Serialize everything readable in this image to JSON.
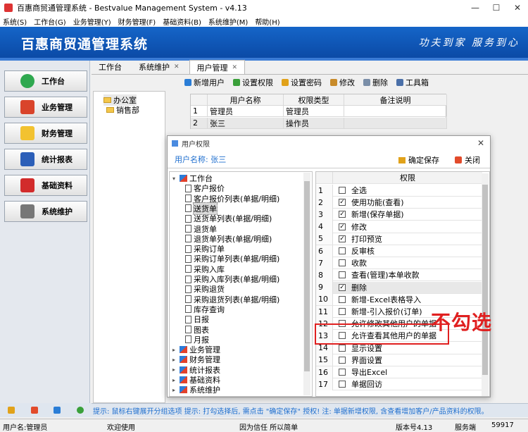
{
  "window": {
    "title": "百惠商贸通管理系统 - Bestvalue Management System - v4.13",
    "min": "—",
    "max": "☐",
    "close": "✕"
  },
  "menu": [
    "系统(S)",
    "工作台(G)",
    "业务管理(Y)",
    "财务管理(F)",
    "基础资料(B)",
    "系统维护(M)",
    "帮助(H)"
  ],
  "banner": {
    "logo": "百惠商贸通管理系统",
    "slogan": "功夫到家  服务到心"
  },
  "nav": [
    {
      "label": "工作台",
      "icon": "check-circle-icon",
      "color": "#2fa84f"
    },
    {
      "label": "业务管理",
      "icon": "house-icon",
      "color": "#d9442b"
    },
    {
      "label": "财务管理",
      "icon": "folder-icon",
      "color": "#f2c230"
    },
    {
      "label": "统计报表",
      "icon": "bar-chart-icon",
      "color": "#2c5fb8"
    },
    {
      "label": "基础资料",
      "icon": "book-icon",
      "color": "#d22b2b"
    },
    {
      "label": "系统维护",
      "icon": "gear-icon",
      "color": "#777777"
    }
  ],
  "tabs": [
    {
      "label": "工作台",
      "closable": false
    },
    {
      "label": "系统维护",
      "closable": true
    },
    {
      "label": "用户管理",
      "closable": true
    }
  ],
  "toolbar": [
    {
      "label": "新增用户",
      "icon": "add-user-icon",
      "color": "#2a7dd6"
    },
    {
      "label": "设置权限",
      "icon": "permission-icon",
      "color": "#3aa03a"
    },
    {
      "label": "设置密码",
      "icon": "lock-icon",
      "color": "#e1a21a"
    },
    {
      "label": "修改",
      "icon": "edit-icon",
      "color": "#c88b2a"
    },
    {
      "label": "删除",
      "icon": "trash-icon",
      "color": "#7a8ea8"
    },
    {
      "label": "工具箱",
      "icon": "toolbox-icon",
      "color": "#4a6fa8"
    }
  ],
  "depts": [
    "办公室",
    "销售部"
  ],
  "users": {
    "headers": [
      "用户名称",
      "权限类型",
      "备注说明"
    ],
    "rows": [
      [
        "1",
        "管理员",
        "管理员",
        ""
      ],
      [
        "2",
        "张三",
        "操作员",
        ""
      ]
    ]
  },
  "dialog": {
    "title": "用户权限",
    "user_label": "用户名称: 张三",
    "save": "确定保存",
    "close": "关闭",
    "close_x": "✕",
    "perm_header": "权限"
  },
  "tree": [
    {
      "label": "工作台",
      "level": 0,
      "type": "folder",
      "expand": "▾"
    },
    {
      "label": "客户报价",
      "level": 1
    },
    {
      "label": "客户报价列表(单据/明细)",
      "level": 1
    },
    {
      "label": "送货单",
      "level": 1,
      "selected": true
    },
    {
      "label": "送货单列表(单据/明细)",
      "level": 1
    },
    {
      "label": "退货单",
      "level": 1
    },
    {
      "label": "退货单列表(单据/明细)",
      "level": 1
    },
    {
      "label": "采购订单",
      "level": 1
    },
    {
      "label": "采购订单列表(单据/明细)",
      "level": 1
    },
    {
      "label": "采购入库",
      "level": 1
    },
    {
      "label": "采购入库列表(单据/明细)",
      "level": 1
    },
    {
      "label": "采购退货",
      "level": 1
    },
    {
      "label": "采购退货列表(单据/明细)",
      "level": 1
    },
    {
      "label": "库存查询",
      "level": 1
    },
    {
      "label": "日报",
      "level": 1
    },
    {
      "label": "图表",
      "level": 1
    },
    {
      "label": "月报",
      "level": 1
    },
    {
      "label": "业务管理",
      "level": 0,
      "type": "folder",
      "expand": "▸"
    },
    {
      "label": "财务管理",
      "level": 0,
      "type": "folder",
      "expand": "▸"
    },
    {
      "label": "统计报表",
      "level": 0,
      "type": "folder",
      "expand": "▸"
    },
    {
      "label": "基础资料",
      "level": 0,
      "type": "folder",
      "expand": "▸"
    },
    {
      "label": "系统维护",
      "level": 0,
      "type": "folder",
      "expand": "▸"
    }
  ],
  "perms": [
    {
      "n": "1",
      "label": "全选",
      "checked": false
    },
    {
      "n": "2",
      "label": "使用功能(查看)",
      "checked": true
    },
    {
      "n": "3",
      "label": "新增(保存单据)",
      "checked": true
    },
    {
      "n": "4",
      "label": "修改",
      "checked": true
    },
    {
      "n": "5",
      "label": "打印预览",
      "checked": true
    },
    {
      "n": "6",
      "label": "反审核",
      "checked": false
    },
    {
      "n": "7",
      "label": "收款",
      "checked": false
    },
    {
      "n": "8",
      "label": "查看(管理)本单收款",
      "checked": false
    },
    {
      "n": "9",
      "label": "删除",
      "checked": true,
      "hl": true
    },
    {
      "n": "10",
      "label": "新增-Excel表格导入",
      "checked": false
    },
    {
      "n": "11",
      "label": "新增-引入报价(订单)",
      "checked": false
    },
    {
      "n": "12",
      "label": "允许修改其他用户的单据",
      "checked": false
    },
    {
      "n": "13",
      "label": "允许查看其他用户的单据",
      "checked": false
    },
    {
      "n": "14",
      "label": "显示设置",
      "checked": false
    },
    {
      "n": "15",
      "label": "界面设置",
      "checked": false
    },
    {
      "n": "16",
      "label": "导出Excel",
      "checked": false
    },
    {
      "n": "17",
      "label": "单据回访",
      "checked": false
    }
  ],
  "hint": "提示: 鼠标右键展开分组选项  提示: 打勾选择后, 需点击 \"确定保存\" 授权! 注: 单据新增权限, 含查看增加客户/产品资料的权限。",
  "annotation": "不勾选",
  "status": {
    "user": "用户名:管理员",
    "welcome": "欢迎使用",
    "motto": "因为信任 所以简单",
    "version": "版本号4.13",
    "service": "服务端",
    "port": "59917"
  }
}
